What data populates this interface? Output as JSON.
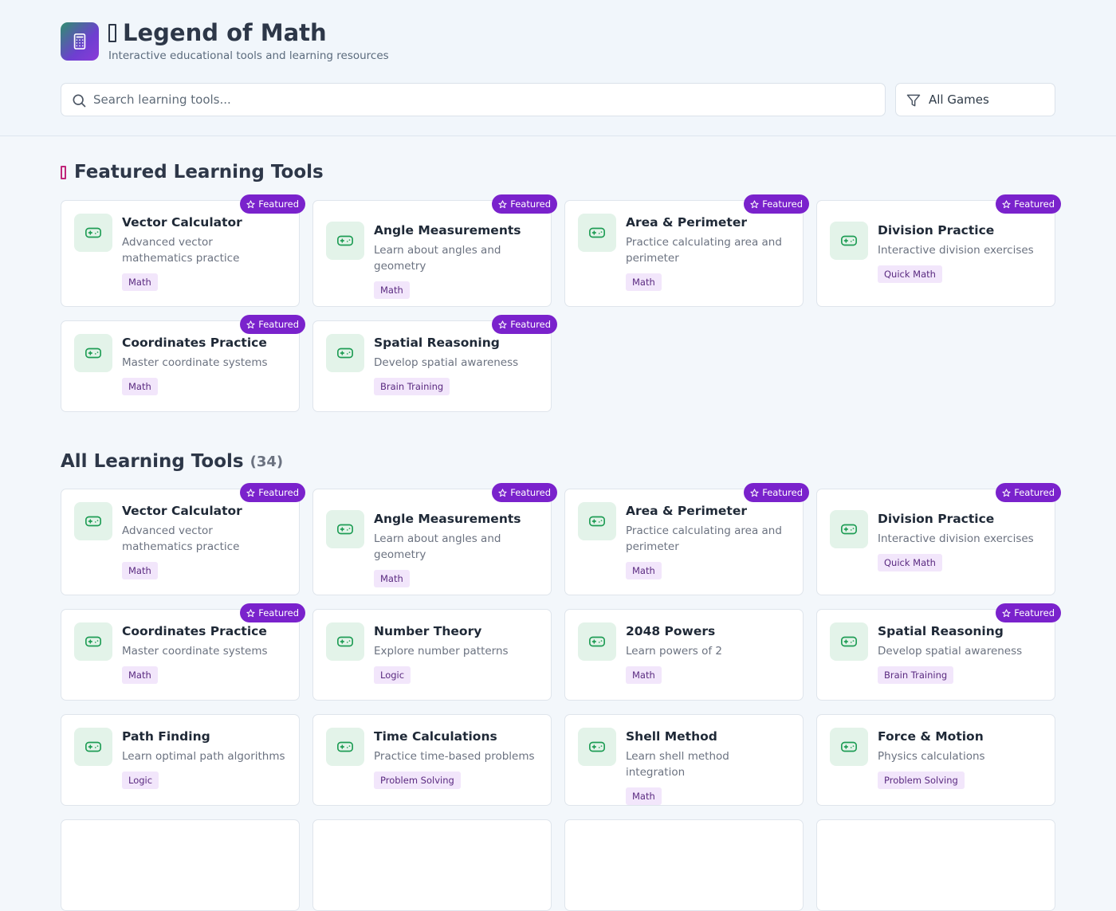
{
  "header": {
    "title": "Legend of Math",
    "subtitle": "Interactive educational tools and learning resources",
    "logo_icon": "calculator-icon",
    "brand_gradient": [
      "#2f8f6f",
      "#8a3bd8"
    ]
  },
  "search": {
    "placeholder": "Search learning tools...",
    "value": ""
  },
  "filter": {
    "selected": "All Games",
    "icon": "filter-icon"
  },
  "featured_section": {
    "title": "Featured Learning Tools",
    "badge_label": "Featured",
    "cards": [
      {
        "title": "Vector Calculator",
        "description": "Advanced vector mathematics practice",
        "tag": "Math",
        "featured": true
      },
      {
        "title": "Angle Measurements",
        "description": "Learn about angles and geometry",
        "tag": "Math",
        "featured": true
      },
      {
        "title": "Area & Perimeter",
        "description": "Practice calculating area and perimeter",
        "tag": "Math",
        "featured": true
      },
      {
        "title": "Division Practice",
        "description": "Interactive division exercises",
        "tag": "Quick Math",
        "featured": true
      },
      {
        "title": "Coordinates Practice",
        "description": "Master coordinate systems",
        "tag": "Math",
        "featured": true
      },
      {
        "title": "Spatial Reasoning",
        "description": "Develop spatial awareness",
        "tag": "Brain Training",
        "featured": true
      }
    ]
  },
  "all_section": {
    "title": "All Learning Tools",
    "count": "(34)",
    "badge_label": "Featured",
    "cards": [
      {
        "title": "Vector Calculator",
        "description": "Advanced vector mathematics practice",
        "tag": "Math",
        "featured": true
      },
      {
        "title": "Angle Measurements",
        "description": "Learn about angles and geometry",
        "tag": "Math",
        "featured": true
      },
      {
        "title": "Area & Perimeter",
        "description": "Practice calculating area and perimeter",
        "tag": "Math",
        "featured": true
      },
      {
        "title": "Division Practice",
        "description": "Interactive division exercises",
        "tag": "Quick Math",
        "featured": true
      },
      {
        "title": "Coordinates Practice",
        "description": "Master coordinate systems",
        "tag": "Math",
        "featured": true
      },
      {
        "title": "Number Theory",
        "description": "Explore number patterns",
        "tag": "Logic",
        "featured": false
      },
      {
        "title": "2048 Powers",
        "description": "Learn powers of 2",
        "tag": "Math",
        "featured": false
      },
      {
        "title": "Spatial Reasoning",
        "description": "Develop spatial awareness",
        "tag": "Brain Training",
        "featured": true
      },
      {
        "title": "Path Finding",
        "description": "Learn optimal path algorithms",
        "tag": "Logic",
        "featured": false
      },
      {
        "title": "Time Calculations",
        "description": "Practice time-based problems",
        "tag": "Problem Solving",
        "featured": false
      },
      {
        "title": "Shell Method",
        "description": "Learn shell method integration",
        "tag": "Math",
        "featured": false
      },
      {
        "title": "Force & Motion",
        "description": "Physics calculations",
        "tag": "Problem Solving",
        "featured": false
      },
      {
        "title": "",
        "description": "",
        "tag": "",
        "featured": false
      },
      {
        "title": "",
        "description": "",
        "tag": "",
        "featured": false
      },
      {
        "title": "",
        "description": "",
        "tag": "",
        "featured": false
      },
      {
        "title": "",
        "description": "",
        "tag": "",
        "featured": false
      }
    ]
  },
  "colors": {
    "accent": "#7a22cc",
    "tag_bg": "#f2e6fb",
    "icon_bg": "#e3f3e9",
    "icon_green": "#1f9d55"
  }
}
